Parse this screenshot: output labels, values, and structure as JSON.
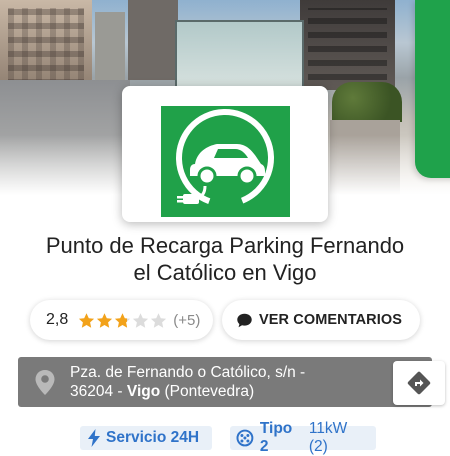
{
  "station": {
    "title_line1": "Punto de Recarga Parking Fernando",
    "title_line2": "el Católico en Vigo"
  },
  "rating": {
    "value": "2,8",
    "stars_filled": 2.8,
    "stars_max": 5,
    "count": "(+5)"
  },
  "comments_button": {
    "label": "VER COMENTARIOS",
    "icon": "chat-bubble-icon"
  },
  "address": {
    "line1": "Pza. de Fernando o Católico, s/n -",
    "postal_code": "36204",
    "city": "Vigo",
    "province": "(Pontevedra)",
    "separator": " - "
  },
  "directions_button": {
    "icon": "directions-icon"
  },
  "features": [
    {
      "icon": "lightning-icon",
      "label": "Servicio 24H",
      "extra": ""
    },
    {
      "icon": "type2-connector-icon",
      "label": "Tipo 2",
      "extra": "11kW (2)"
    }
  ],
  "colors": {
    "brand_green": "#20a149",
    "address_bg": "#7a7a7a",
    "feature_blue": "#2f73c9",
    "star_gold": "#f2a21a"
  },
  "logo": {
    "icon": "electric-car-plug-icon"
  }
}
